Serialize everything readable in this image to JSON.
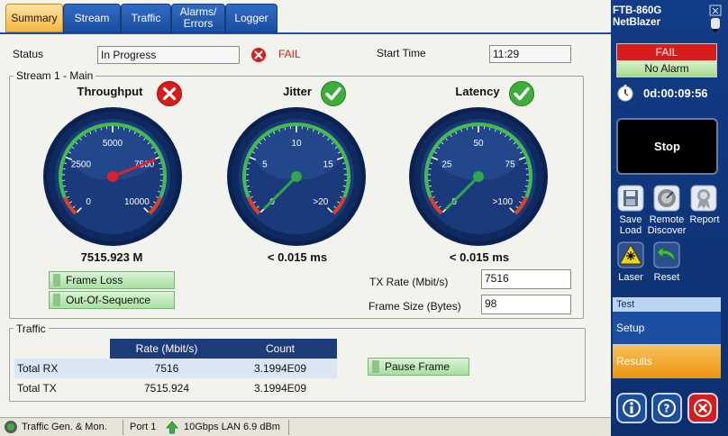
{
  "tabs": [
    {
      "label": "Summary",
      "active": true
    },
    {
      "label": "Stream",
      "active": false
    },
    {
      "label": "Traffic",
      "active": false
    },
    {
      "label": "Alarms/\nErrors",
      "active": false
    },
    {
      "label": "Logger",
      "active": false
    }
  ],
  "status": {
    "label": "Status",
    "value": "In Progress",
    "verdict": "FAIL",
    "start_time_label": "Start Time",
    "start_time": "11:29"
  },
  "stream_group": {
    "title": "Stream 1 - Main",
    "gauges": [
      {
        "title": "Throughput",
        "status": "fail",
        "ticks": [
          "0",
          "2500",
          "5000",
          "7500",
          "10000"
        ],
        "value_text": "7515.923 M",
        "needle_fraction": 0.7516
      },
      {
        "title": "Jitter",
        "status": "pass",
        "ticks": [
          "0",
          "5",
          "10",
          "15",
          ">20"
        ],
        "value_text": "< 0.015 ms",
        "needle_fraction": 0.0
      },
      {
        "title": "Latency",
        "status": "pass",
        "ticks": [
          "0",
          "25",
          "50",
          "75",
          ">100"
        ],
        "value_text": "< 0.015 ms",
        "needle_fraction": 0.0
      }
    ],
    "indicators": [
      "Frame Loss",
      "Out-Of-Sequence"
    ],
    "tx_rate_label": "TX Rate (Mbit/s)",
    "tx_rate_value": "7516",
    "frame_size_label": "Frame Size (Bytes)",
    "frame_size_value": "98"
  },
  "traffic_group": {
    "title": "Traffic",
    "columns": [
      "",
      "Rate (Mbit/s)",
      "Count"
    ],
    "rows": [
      [
        "Total RX",
        "7516",
        "3.1994E09"
      ],
      [
        "Total TX",
        "7515.924",
        "3.1994E09"
      ]
    ],
    "pause_frame_label": "Pause Frame"
  },
  "status_bar": {
    "app": "Traffic Gen. & Mon.",
    "port": "Port 1",
    "link": "10Gbps LAN",
    "power": "6.9 dBm"
  },
  "side_panel": {
    "device_line1": "FTB-860G",
    "device_line2": "NetBlazer",
    "verdict": "FAIL",
    "alarm": "No Alarm",
    "timer": "0d:00:09:56",
    "stop_label": "Stop",
    "buttons": [
      {
        "label": "Save\nLoad"
      },
      {
        "label": "Remote\nDiscover"
      },
      {
        "label": "Report"
      },
      {
        "label": "Laser"
      },
      {
        "label": "Reset"
      }
    ],
    "test_header": "Test",
    "setup_label": "Setup",
    "results_label": "Results"
  },
  "colors": {
    "tab_blue": "#2f6bc4",
    "tab_active": "#f5b63c",
    "gauge_face": "#1a3a7c",
    "gauge_bezel": "#0f2a5e",
    "needle_red": "#e0202a",
    "needle_green": "#2fa84a",
    "fail_red": "#d81c1c",
    "side_bg": "#123c86",
    "results_orange": "#f0a020"
  }
}
